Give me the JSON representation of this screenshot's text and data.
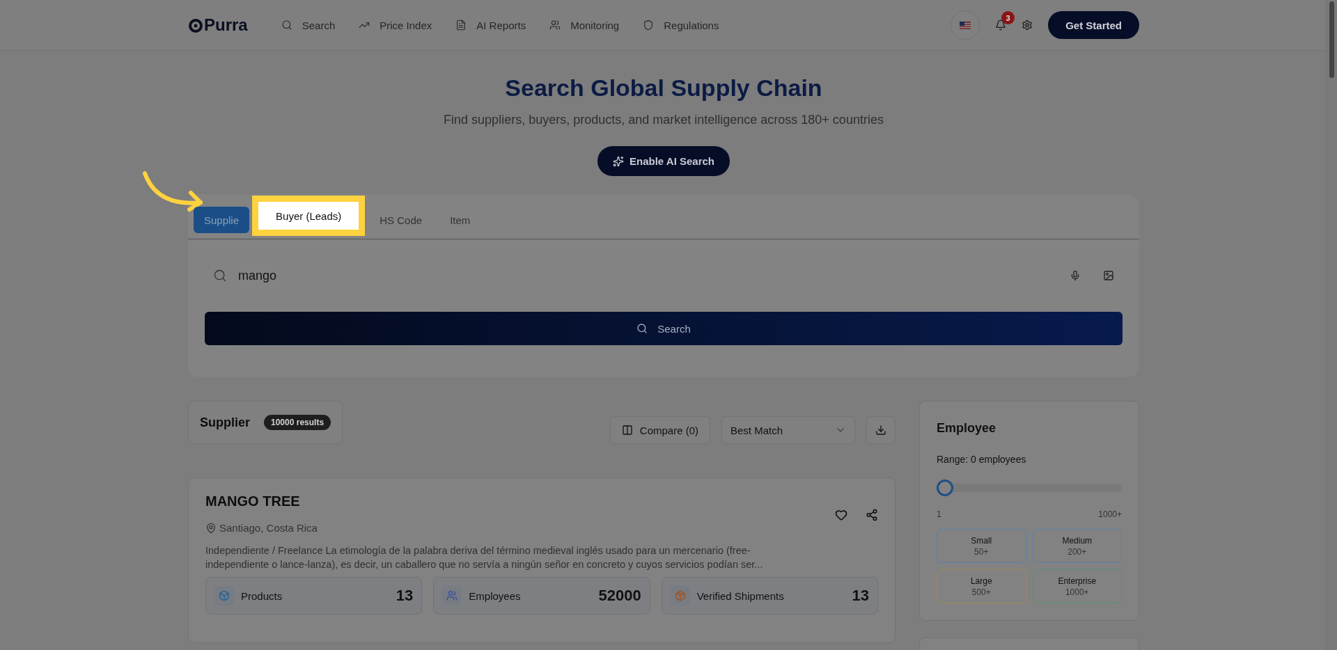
{
  "header": {
    "logo": "Purra",
    "nav": [
      {
        "label": "Search"
      },
      {
        "label": "Price Index"
      },
      {
        "label": "AI Reports"
      },
      {
        "label": "Monitoring"
      },
      {
        "label": "Regulations"
      }
    ],
    "notifications": "3",
    "cta": "Get Started"
  },
  "hero": {
    "title": "Search Global Supply Chain",
    "subtitle": "Find suppliers, buyers, products, and market intelligence across 180+ countries",
    "ai_button": "Enable AI Search"
  },
  "search": {
    "tabs": [
      {
        "label": "Supplie",
        "selected": true,
        "highlighted": false
      },
      {
        "label": "Buyer (Leads)",
        "selected": false,
        "highlighted": true
      },
      {
        "label": "HS Code",
        "selected": false,
        "highlighted": false
      },
      {
        "label": "Item",
        "selected": false,
        "highlighted": false
      }
    ],
    "query": "mango",
    "button": "Search"
  },
  "results": {
    "title": "Supplier",
    "count": "10000 results",
    "compare": "Compare (0)",
    "sort": "Best Match"
  },
  "card": {
    "name": "MANGO TREE",
    "location": "Santiago, Costa Rica",
    "description": "Independiente / Freelance La etimología de la palabra deriva del término medieval inglés usado para un mercenario (free-independiente o lance-lanza), es decir, un caballero que no servía a ningún señor en concreto y cuyos servicios podían ser...",
    "stats": [
      {
        "label": "Products",
        "value": "13",
        "color": "#1f5f99"
      },
      {
        "label": "Employees",
        "value": "52000",
        "color": "#3a4fa0"
      },
      {
        "label": "Verified Shipments",
        "value": "13",
        "color": "#a0501a"
      }
    ]
  },
  "employee_filter": {
    "title": "Employee",
    "range": "Range: 0 employees",
    "level": 0,
    "min": "1",
    "max": "1000+",
    "sizes": [
      {
        "label": "Small",
        "value": "50+",
        "color": "#5a7fb0"
      },
      {
        "label": "Medium",
        "value": "200+",
        "color": "#5a7fb0"
      },
      {
        "label": "Large",
        "value": "500+",
        "color": "#a08a50"
      },
      {
        "label": "Enterprise",
        "value": "1000+",
        "color": "#5a9070"
      }
    ]
  }
}
